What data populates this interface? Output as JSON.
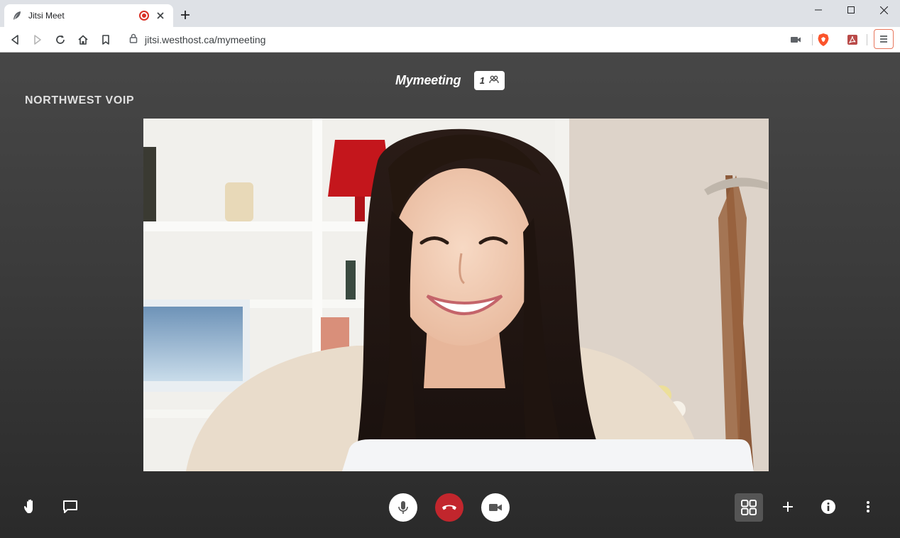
{
  "browser": {
    "tab": {
      "title": "Jitsi Meet"
    },
    "address": {
      "url": "jitsi.westhost.ca/mymeeting"
    }
  },
  "meeting": {
    "name": "Mymeeting",
    "participant_count": "1",
    "watermark": "NORTHWEST VOIP"
  },
  "toolbar": {
    "left": [
      "raise-hand",
      "chat"
    ],
    "center": [
      "microphone",
      "hangup",
      "camera"
    ],
    "right": [
      "tile-view",
      "invite",
      "info",
      "more"
    ]
  },
  "colors": {
    "hangup": "#c2262d",
    "stage_top": "#474747",
    "stage_bottom": "#2a2a2a",
    "tile_button": "#555555",
    "tab_bar": "#dee1e6"
  }
}
